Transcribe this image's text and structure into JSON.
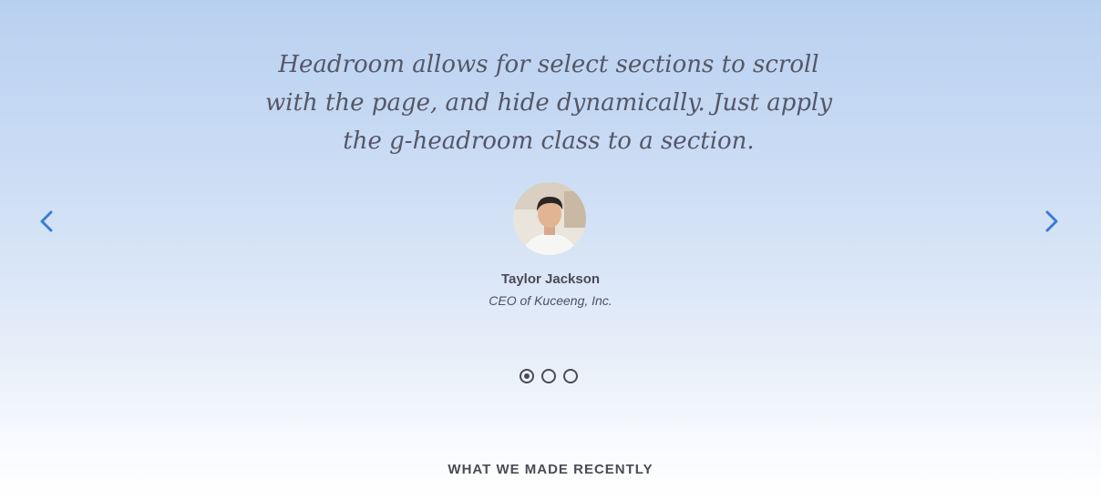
{
  "testimonial": {
    "quote": "Headroom allows for select sections to scroll with the page, and hide dynamically. Just apply the g-headroom class to a section.",
    "name": "Taylor Jackson",
    "role": "CEO of Kuceeng, Inc."
  },
  "carousel": {
    "prev_icon": "chevron-left-icon",
    "next_icon": "chevron-right-icon",
    "slides_count": 3,
    "active_slide": 1,
    "accent_color": "#3a7bd5"
  },
  "section": {
    "heading": "WHAT WE MADE RECENTLY"
  }
}
